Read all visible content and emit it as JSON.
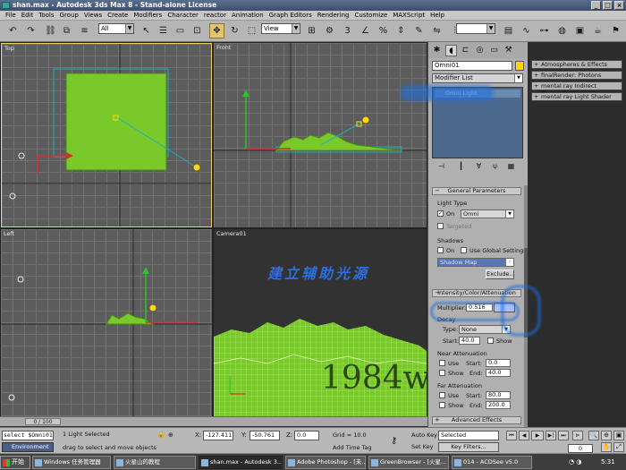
{
  "window": {
    "title": "shan.max - Autodesk 3ds Max 8 - Stand-alone License"
  },
  "menu": [
    "File",
    "Edit",
    "Tools",
    "Group",
    "Views",
    "Create",
    "Modifiers",
    "Character",
    "reactor",
    "Animation",
    "Graph Editors",
    "Rendering",
    "Customize",
    "MAXScript",
    "Help"
  ],
  "toolbar": {
    "selection_filter": "All",
    "ref_coord": "View",
    "named_sel": ""
  },
  "viewports": {
    "top": "Top",
    "front": "Front",
    "left": "Left",
    "camera": "Camera01"
  },
  "overlay": {
    "chinese_caption": "建立辅助光源",
    "watermark": "1984wl"
  },
  "timeslider": {
    "frame": "0 / 100"
  },
  "command_panel": {
    "object_name": "Omni01",
    "object_color": "#ffd800",
    "modifier_list": "Modifier List",
    "stack_item": "Omni Light",
    "general": {
      "title": "General Parameters",
      "light_type_label": "Light Type",
      "on_label": "On",
      "type_value": "Omni",
      "targeted_label": "Targeted",
      "shadows_label": "Shadows",
      "shadow_on_label": "On",
      "global_label": "Use Global Settings",
      "shadow_type": "Shadow Map",
      "exclude_label": "Exclude..."
    },
    "intensity": {
      "title": "Intensity/Color/Attenuation",
      "multiplier_label": "Multiplier:",
      "multiplier_value": "0.516",
      "decay_label": "Decay",
      "decay_type_label": "Type:",
      "decay_type_value": "None",
      "start_label": "Start:",
      "start_value": "40.0",
      "show_label": "Show",
      "near_title": "Near Attenuation",
      "near_use": "Use",
      "near_show": "Show",
      "near_start_label": "Start:",
      "near_start_value": "0.0",
      "near_end_label": "End:",
      "near_end_value": "40.0",
      "far_title": "Far Attenuation",
      "far_use": "Use",
      "far_show": "Show",
      "far_start_label": "Start:",
      "far_start_value": "80.0",
      "far_end_label": "End:",
      "far_end_value": "200.0"
    },
    "advanced": "Advanced Effects"
  },
  "extra_rollouts": [
    "Atmospheres & Effects",
    "finalRender: Photons",
    "mental ray Indirect Illumination",
    "mental ray Light Shader"
  ],
  "status": {
    "maxscript": "select $Omni01",
    "environment": "Environment",
    "selected": "1 Light Selected",
    "prompt": "drag to select and move objects",
    "x_value": "-127.411",
    "y_value": "-50.761",
    "z_value": "0.0",
    "grid": "Grid = 10.0",
    "add_time_tag": "Add Time Tag",
    "auto_key": "Auto Key",
    "set_key": "Set Key",
    "key_mode": "Selected",
    "key_filters": "Key Filters...",
    "current_frame": "0"
  },
  "taskbar": {
    "start": "开始",
    "tasks": [
      "Windows 任务管理器",
      "火星山的教程",
      "shan.max - Autodesk 3...",
      "Adobe Photoshop - [未...",
      "GreenBrowser - [火星...",
      "014 - ACDSee v5.0"
    ],
    "clock": "5:31"
  },
  "ticks": [
    "10",
    "15",
    "20",
    "25",
    "30",
    "35",
    "40",
    "45",
    "50",
    "55",
    "60",
    "65",
    "70",
    "75",
    "80",
    "85",
    "90",
    "95"
  ],
  "colors": {
    "accent": "#e2c56a",
    "grass": "#7ac92a",
    "stack": "#4c6a8e"
  }
}
